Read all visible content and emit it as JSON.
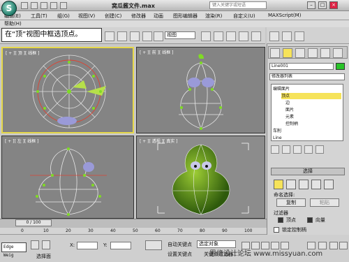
{
  "window": {
    "title": "窝瓜酱文件.max",
    "search_placeholder": "键入关键字或短语"
  },
  "menu": [
    "编辑(E)",
    "工具(T)",
    "组(G)",
    "视图(V)",
    "创建(C)",
    "修改器",
    "动画",
    "图形编辑器",
    "渲染(R)",
    "自定义(U)",
    "MAXScript(M)"
  ],
  "menu_row2": [
    "帮助(H)"
  ],
  "toolbar": {
    "view_select": "视图"
  },
  "callout": "在“顶”视图中框选顶点。",
  "viewports": {
    "top": "[ + ][ 顶 ][ 线框 ]",
    "front": "[ + ][ 前 ][ 线框 ]",
    "left": "[ + ][ 左 ][ 线框 ]",
    "perspective": "[ + ][ 透视 ][ 真实 ]"
  },
  "command_panel": {
    "object_name": "Line001",
    "object_color": "#28c428",
    "modifier_list": "修改器列表",
    "stack": [
      {
        "label": "编辑面片",
        "selected": false
      },
      {
        "label": "顶点",
        "selected": true
      },
      {
        "label": "边",
        "selected": false
      },
      {
        "label": "面片",
        "selected": false
      },
      {
        "label": "元素",
        "selected": false
      },
      {
        "label": "控制柄",
        "selected": false
      },
      {
        "label": "车削",
        "selected": false
      },
      {
        "label": "Line",
        "selected": false
      }
    ],
    "selection_rollout": "选择",
    "named_selection_label": "命名选择:",
    "copy_button": "复制",
    "paste_button": "粘贴",
    "filter_label": "过滤器",
    "filter_vertex": "顶点",
    "filter_vector": "向量",
    "lock_handles": "锁定控制柄"
  },
  "timeline": {
    "frame": "0 / 100",
    "ticks": [
      "0",
      "10",
      "20",
      "30",
      "40",
      "50",
      "60",
      "70",
      "80",
      "90",
      "100"
    ]
  },
  "status": {
    "maxscript_box": "Edge Weig",
    "prompt": "选择面",
    "x_label": "X:",
    "y_label": "Y:",
    "auto_key": "自动关键点",
    "set_key": "设置关键点",
    "key_filter": "关键点过滤器...",
    "selected_object": "选定对象"
  },
  "watermark": "思缘设计论坛  www.missyuan.com"
}
